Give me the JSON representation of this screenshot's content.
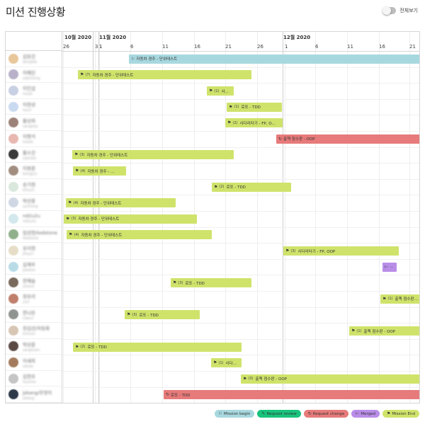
{
  "header": {
    "title": "미션 진행상황",
    "toggle_label": "전체보기"
  },
  "colors": {
    "mission_begin": "#a8d8df",
    "request_review": "#19c37d",
    "request_change": "#e77a7a",
    "merged": "#b98de8",
    "mission_end": "#cfe36b"
  },
  "timeline": {
    "months": [
      "10월 2020",
      "11월 2020",
      "12월 2020"
    ],
    "ticks": [
      "26",
      "31",
      "1",
      "6",
      "11",
      "16",
      "21",
      "26",
      "1",
      "6",
      "11",
      "16",
      "21"
    ]
  },
  "users": [
    {
      "name": "김동진",
      "sub": "donglee"
    },
    {
      "name": "이예진",
      "sub": "yejinhong"
    },
    {
      "name": "이인섭",
      "sub": "insub"
    },
    {
      "name": "이현성",
      "sub": "hyun"
    },
    {
      "name": "황상희",
      "sub": "sanghee"
    },
    {
      "name": "이형석",
      "sub": "hseok"
    },
    {
      "name": "황소진",
      "sub": "sojinlee"
    },
    {
      "name": "이봉준",
      "sub": "bongjun"
    },
    {
      "name": "송기현",
      "sub": "kihyun"
    },
    {
      "name": "박선홍",
      "sub": "sunhong"
    },
    {
      "name": "nd2u2u",
      "sub": "nd2u2u"
    },
    {
      "name": "임성현/tedstone",
      "sub": "tedstone"
    },
    {
      "name": "유지현",
      "sub": "jihyun"
    },
    {
      "name": "김재우",
      "sub": "jaewoo"
    },
    {
      "name": "한예슬",
      "sub": "yeseul"
    },
    {
      "name": "정유리",
      "sub": "yuri"
    },
    {
      "name": "한나은",
      "sub": "naeun"
    },
    {
      "name": "장김선/자동화",
      "sub": "kimsun"
    },
    {
      "name": "박상훈",
      "sub": "sanghoon"
    },
    {
      "name": "이세희",
      "sub": "sehee"
    },
    {
      "name": "김현호",
      "sub": "hyunho"
    },
    {
      "name": "jskang/무엇이",
      "sub": "jskang"
    }
  ],
  "bars": [
    {
      "row": 0,
      "status": "mission_begin",
      "count": "",
      "label": "자동차 경주 - 단위테스트"
    },
    {
      "row": 1,
      "status": "mission_end",
      "count": "(7)",
      "label": "자동차 경주 - 단위테스트"
    },
    {
      "row": 2,
      "status": "mission_end",
      "count": "(1)",
      "label": "사..."
    },
    {
      "row": 3,
      "status": "mission_end",
      "count": "(1)",
      "label": "로또 - TDD"
    },
    {
      "row": 4,
      "status": "mission_end",
      "count": "(2)",
      "label": "사다리타기 - FP, O..."
    },
    {
      "row": 5,
      "status": "request_change",
      "count": "",
      "label": "출첵 점수판 - OOP"
    },
    {
      "row": 6,
      "status": "mission_end",
      "count": "(3)",
      "label": "자동차 경주 - 단위테스트"
    },
    {
      "row": 7,
      "status": "mission_end",
      "count": "(4)",
      "label": "자동차 경주 - ..."
    },
    {
      "row": 8,
      "status": "mission_end",
      "count": "(2)",
      "label": "로또 - TDD"
    },
    {
      "row": 9,
      "status": "mission_end",
      "count": "(4)",
      "label": "자동차 경주 - 단위테스트"
    },
    {
      "row": 10,
      "status": "mission_end",
      "count": "(3)",
      "label": "자동차 경주 - 단위테스트"
    },
    {
      "row": 11,
      "status": "mission_end",
      "count": "(4)",
      "label": "자동차 경주 - 단위테스트"
    },
    {
      "row": 12,
      "status": "mission_end",
      "count": "(3)",
      "label": "사다리타기 - FP, OOP"
    },
    {
      "row": 13,
      "status": "merged",
      "count": "",
      "label": "..."
    },
    {
      "row": 14,
      "status": "mission_end",
      "count": "(3)",
      "label": "로또 - TDD"
    },
    {
      "row": 15,
      "status": "mission_end",
      "count": "(1)",
      "label": "출첵 점수판..."
    },
    {
      "row": 16,
      "status": "mission_end",
      "count": "(3)",
      "label": "로또 - TDD"
    },
    {
      "row": 17,
      "status": "mission_end",
      "count": "(1)",
      "label": "출첵 점수판 - OOP"
    },
    {
      "row": 18,
      "status": "mission_end",
      "count": "(2)",
      "label": "로또 - TDD"
    },
    {
      "row": 19,
      "status": "mission_end",
      "count": "(1)",
      "label": "사다..."
    },
    {
      "row": 20,
      "status": "mission_end",
      "count": "(3)",
      "label": "출첵 점수판 - OOP"
    },
    {
      "row": 21,
      "status": "request_change",
      "count": "",
      "label": "로또 - TDD"
    }
  ],
  "legend": [
    {
      "status": "mission_begin",
      "label": "Mission begin"
    },
    {
      "status": "request_review",
      "label": "Request review"
    },
    {
      "status": "request_change",
      "label": "Request change"
    },
    {
      "status": "merged",
      "label": "Merged"
    },
    {
      "status": "mission_end",
      "label": "Mission End"
    }
  ]
}
